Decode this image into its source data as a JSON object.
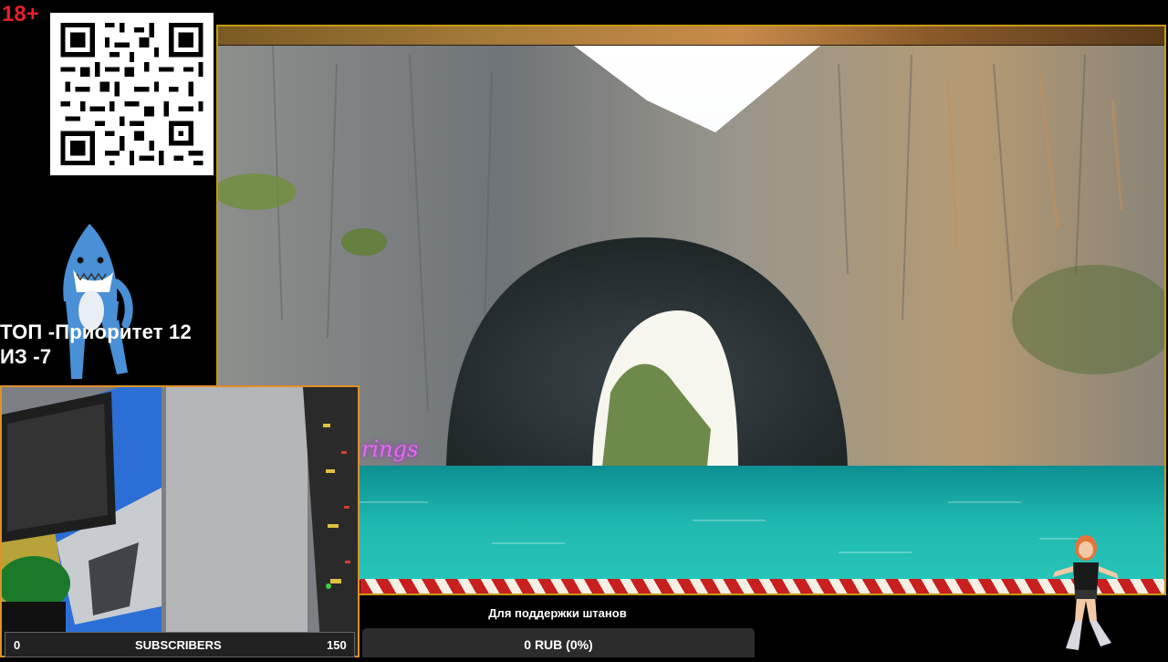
{
  "badge": {
    "age_rating": "18+"
  },
  "priority": {
    "line1": "ТОП -Приоритет 12",
    "line2": "ИЗ -7"
  },
  "video": {
    "overlay_text": "rings"
  },
  "subscribers": {
    "current": "0",
    "label": "SUBSCRIBERS",
    "goal": "150",
    "progress": 0
  },
  "donation": {
    "title": "Для поддержки штанов",
    "value": "0 RUB (0%)",
    "progress": 0
  },
  "colors": {
    "age_red": "#e8202a",
    "frame_gold": "#c59a12",
    "cam_orange": "#e0902a",
    "overlay_purple": "#e26cf3",
    "water": "#1fb8b0"
  },
  "icons": {
    "qr": "qr-code-icon",
    "shark": "dancing-shark-mascot",
    "girl": "dancing-girl-mascot"
  }
}
